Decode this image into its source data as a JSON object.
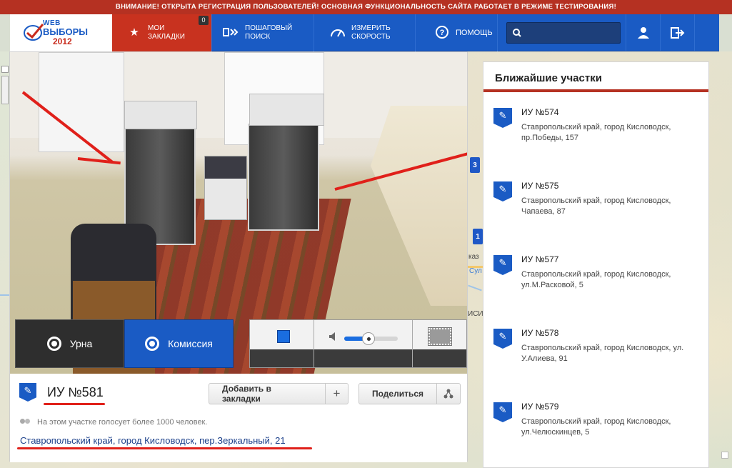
{
  "notice": "ВНИМАНИЕ! ОТКРЫТА РЕГИСТРАЦИЯ ПОЛЬЗОВАТЕЛЕЙ! ОСНОВНАЯ ФУНКЦИОНАЛЬНОСТЬ САЙТА РАБОТАЕТ В РЕЖИМЕ ТЕСТИРОВАНИЯ!",
  "logo": {
    "web": "WEB",
    "vybory": "ВЫБОРЫ",
    "year": "2012"
  },
  "nav": {
    "bookmarks_line1": "МОИ",
    "bookmarks_line2": "ЗАКЛАДКИ",
    "bookmarks_count": "0",
    "step_line1": "ПОШАГОВЫЙ",
    "step_line2": "ПОИСК",
    "speed_line1": "ИЗМЕРИТЬ",
    "speed_line2": "СКОРОСТЬ",
    "help": "ПОМОЩЬ",
    "search_value": ""
  },
  "colors": {
    "brand_blue": "#1a5bc4",
    "accent_red": "#b53122",
    "annotation_red": "#e0201a"
  },
  "icons": {
    "bookmarks": "star-icon",
    "step": "step-search-icon",
    "speed": "speedometer-icon",
    "help": "help-icon",
    "search": "search-icon",
    "user": "user-icon",
    "logout": "logout-icon",
    "camera": "camera-icon",
    "volume": "speaker-icon",
    "fullscreen": "fullscreen-icon",
    "add": "plus-icon",
    "share": "share-icon",
    "people": "people-icon",
    "ballot": "ballot-icon"
  },
  "video": {
    "tab_urn": "Урна",
    "tab_commission": "Комиссия",
    "volume_level": 0.45
  },
  "station": {
    "title": "ИУ №581",
    "add_bookmark": "Добавить в закладки",
    "share": "Поделиться",
    "voters": "На этом участке голосует более 1000 человек.",
    "address": "Ставропольский край, город Кисловодск, пер.Зеркальный, 21"
  },
  "sidebar": {
    "title": "Ближайшие участки",
    "items": [
      {
        "name": "ИУ №574",
        "address": "Ставропольский край, город Кисловодск, пр.Победы, 157"
      },
      {
        "name": "ИУ №575",
        "address": "Ставропольский край, город Кисловодск, Чапаева, 87"
      },
      {
        "name": "ИУ №577",
        "address": "Ставропольский край, город Кисловодск, ул.М.Расковой, 5"
      },
      {
        "name": "ИУ №578",
        "address": "Ставропольский край, город Кисловодск, ул. У.Алиева, 91"
      },
      {
        "name": "ИУ №579",
        "address": "Ставропольский край, город Кисловодск, ул.Челюскинцев, 5"
      }
    ]
  },
  "map": {
    "pin1": "3",
    "pin2": "1",
    "label1": "каз",
    "label2": "Сул",
    "label3": "ИСИ"
  }
}
